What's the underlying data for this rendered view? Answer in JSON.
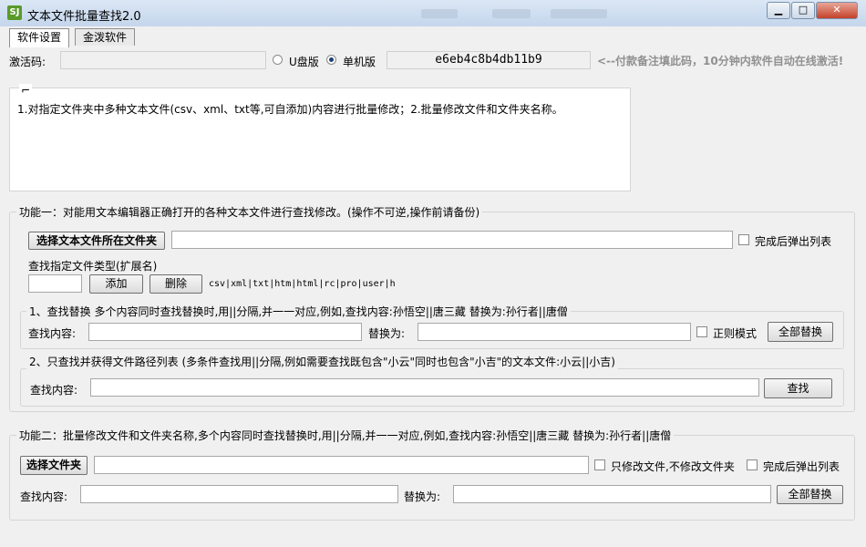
{
  "window": {
    "title": "文本文件批量查找2.0",
    "icon_text": "SJ",
    "controls": {
      "minimize": "▁",
      "maximize": "□",
      "close": "✕"
    }
  },
  "tabs": [
    {
      "label": "软件设置",
      "active": true
    },
    {
      "label": "金泼软件",
      "active": false
    }
  ],
  "activation": {
    "label": "激活码:",
    "input_value": "",
    "radio_u": "U盘版",
    "radio_single": "单机版",
    "selected": "单机版",
    "machine_code": "e6eb4c8b4db11b9",
    "notice": "<--付款备注填此码，10分钟内软件自动在线激活!"
  },
  "description": {
    "stub": "⌐",
    "text": "1.对指定文件夹中多种文本文件(csv、xml、txt等,可自添加)内容进行批量修改；2.批量修改文件和文件夹名称。"
  },
  "func1": {
    "title": "功能一：对能用文本编辑器正确打开的各种文本文件进行查找修改。(操作不可逆,操作前请备份)",
    "select_folder_btn": "选择文本文件所在文件夹",
    "folder_path": "",
    "popup_after_label": "完成后弹出列表",
    "ext_label": "查找指定文件类型(扩展名)",
    "ext_input": "",
    "add_btn": "添加",
    "delete_btn": "删除",
    "ext_list": "csv|xml|txt|htm|html|rc|pro|user|h",
    "replace_group": {
      "legend": "1、查找替换 多个内容同时查找替换时,用||分隔,并一一对应,例如,查找内容:孙悟空||唐三藏 替换为:孙行者||唐僧",
      "find_label": "查找内容:",
      "find_value": "",
      "replace_label": "替换为:",
      "replace_value": "",
      "regex_label": "正则模式",
      "replace_all_btn": "全部替换"
    },
    "search_group": {
      "legend": "2、只查找并获得文件路径列表 (多条件查找用||分隔,例如需要查找既包含\"小云\"同时也包含\"小吉\"的文本文件:小云||小吉)",
      "find_label": "查找内容:",
      "find_value": "",
      "search_btn": "查找"
    }
  },
  "func2": {
    "title": "功能二：批量修改文件和文件夹名称,多个内容同时查找替换时,用||分隔,并一一对应,例如,查找内容:孙悟空||唐三藏 替换为:孙行者||唐僧",
    "select_folder_btn": "选择文件夹",
    "folder_path": "",
    "only_files_label": "只修改文件,不修改文件夹",
    "popup_after_label": "完成后弹出列表",
    "find_label": "查找内容:",
    "find_value": "",
    "replace_label": "替换为:",
    "replace_value": "",
    "replace_all_btn": "全部替换"
  }
}
